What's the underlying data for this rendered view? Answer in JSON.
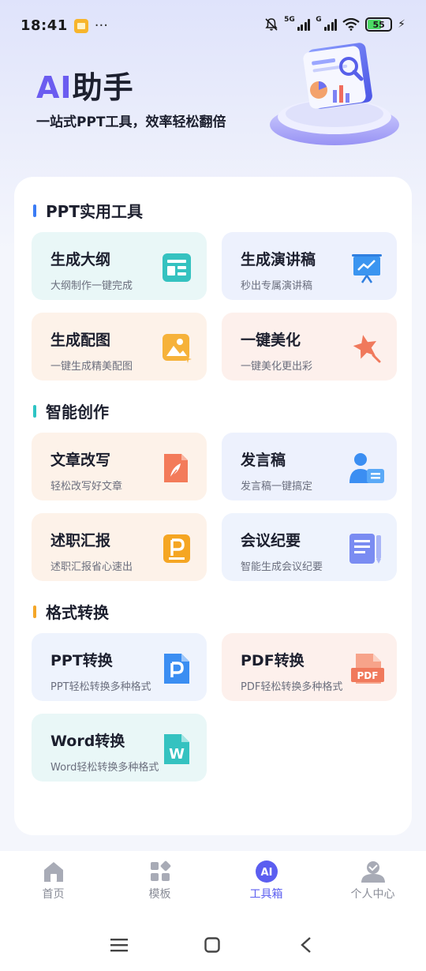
{
  "status_bar": {
    "time": "18:41",
    "dots": "···",
    "net1": "5G",
    "net2": "G",
    "battery": "55"
  },
  "hero": {
    "title_ai": "AI",
    "title_rest": "助手",
    "subtitle": "一站式PPT工具，效率轻松翻倍"
  },
  "sections": [
    {
      "title": "PPT实用工具",
      "accent": "#3b7cf5",
      "tools": [
        {
          "title": "生成大纲",
          "desc": "大纲制作一键完成",
          "icon": "outline-icon"
        },
        {
          "title": "生成演讲稿",
          "desc": "秒出专属演讲稿",
          "icon": "presentation-board-icon"
        },
        {
          "title": "生成配图",
          "desc": "一键生成精美配图",
          "icon": "image-generate-icon"
        },
        {
          "title": "一键美化",
          "desc": "一键美化更出彩",
          "icon": "magic-star-icon"
        }
      ]
    },
    {
      "title": "智能创作",
      "accent": "#2ec4c4",
      "tools": [
        {
          "title": "文章改写",
          "desc": "轻松改写好文章",
          "icon": "feather-document-icon"
        },
        {
          "title": "发言稿",
          "desc": "发言稿一键搞定",
          "icon": "speaker-user-icon"
        },
        {
          "title": "述职汇报",
          "desc": "述职汇报省心速出",
          "icon": "report-p-icon"
        },
        {
          "title": "会议纪要",
          "desc": "智能生成会议纪要",
          "icon": "meeting-notes-icon"
        }
      ]
    },
    {
      "title": "格式转换",
      "accent": "#f4a628",
      "tools": [
        {
          "title": "PPT转换",
          "desc": "PPT轻松转换多种格式",
          "icon": "ppt-file-icon"
        },
        {
          "title": "PDF转换",
          "desc": "PDF轻松转换多种格式",
          "icon": "pdf-file-icon",
          "icon_text": "PDF"
        },
        {
          "title": "Word转换",
          "desc": "Word轻松转换多种格式",
          "icon": "word-file-icon",
          "icon_text": "W"
        }
      ]
    }
  ],
  "bottom_nav": [
    {
      "label": "首页",
      "icon": "home-icon",
      "active": false
    },
    {
      "label": "模板",
      "icon": "template-icon",
      "active": false
    },
    {
      "label": "工具箱",
      "icon": "ai-toolbox-icon",
      "active": true,
      "icon_text": "AI"
    },
    {
      "label": "个人中心",
      "icon": "profile-icon",
      "active": false
    }
  ],
  "colors": {
    "accent": "#5b5ef0",
    "brand_ai": "#6b5cf0"
  }
}
